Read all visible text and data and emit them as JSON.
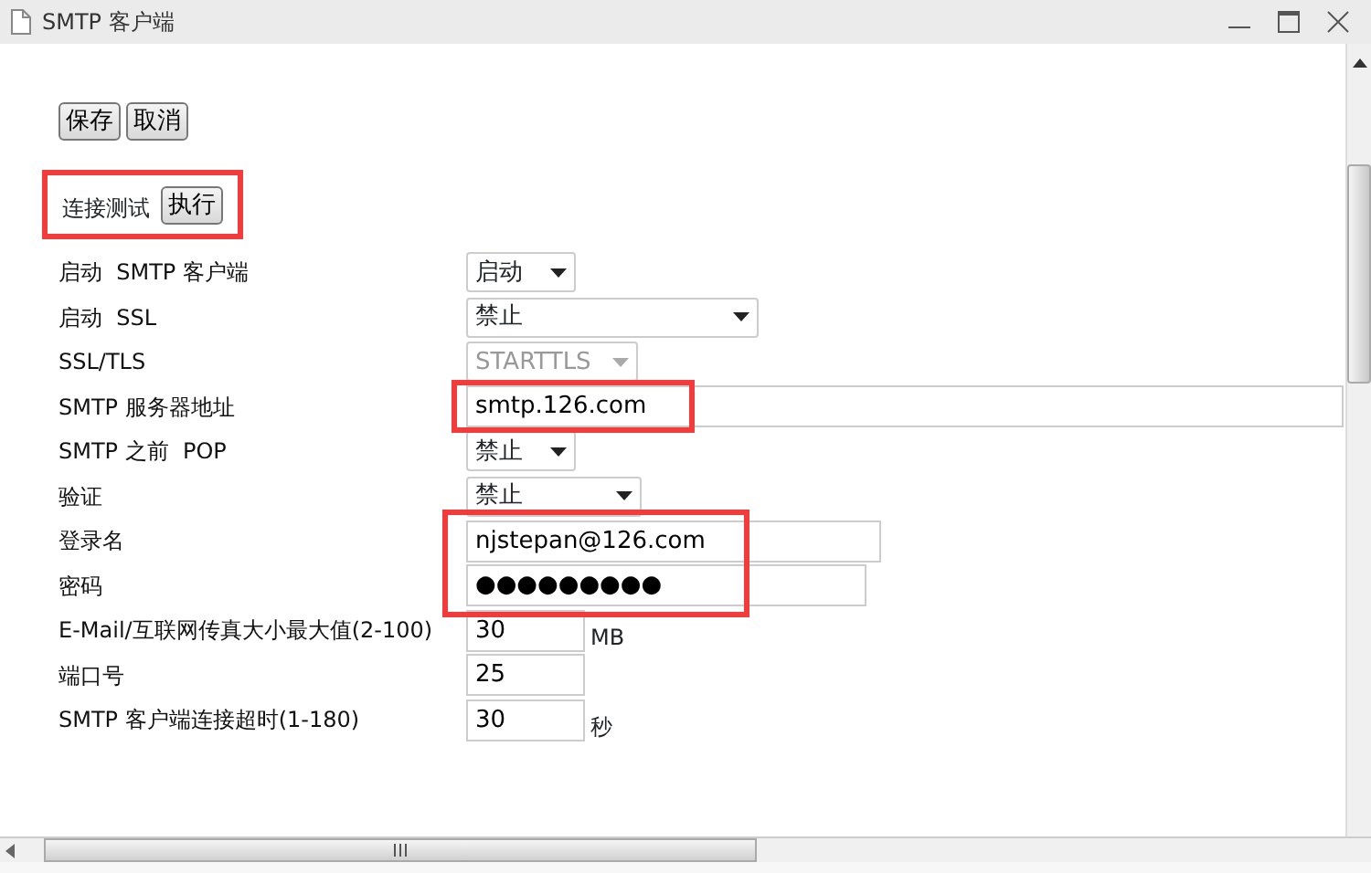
{
  "window": {
    "title": "SMTP 客户端"
  },
  "buttons": [
    {
      "label": "保存"
    },
    {
      "label": "取消"
    }
  ],
  "connection_test": {
    "label": "连接测试",
    "button": "执行",
    "highlighted": true
  },
  "settings": [
    {
      "label": "启动  SMTP 客户端",
      "kind": "select",
      "value": "启动",
      "disabled": false,
      "highlighted": false
    },
    {
      "label": "启动  SSL",
      "kind": "select",
      "value": "禁止",
      "disabled": false,
      "highlighted": false
    },
    {
      "label": "SSL/TLS",
      "kind": "select",
      "value": "STARTTLS",
      "disabled": true,
      "highlighted": false
    },
    {
      "label": "SMTP 服务器地址",
      "kind": "input",
      "value": "smtp.126.com",
      "highlighted": true
    },
    {
      "label": "SMTP 之前  POP",
      "kind": "select",
      "value": "禁止",
      "disabled": false,
      "highlighted": false
    },
    {
      "label": "验证",
      "kind": "select",
      "value": "禁止",
      "disabled": false,
      "highlighted": false
    },
    {
      "label": "登录名",
      "kind": "input",
      "value": "njstepan@126.com",
      "highlighted": true
    },
    {
      "label": "密码",
      "kind": "input",
      "value": "●●●●●●●●●",
      "highlighted": true
    },
    {
      "label": "E-Mail/互联网传真大小最大值(2-100)",
      "kind": "input",
      "value": "30",
      "unit": "MB",
      "highlighted": false
    },
    {
      "label": "端口号",
      "kind": "input",
      "value": "25",
      "highlighted": false
    },
    {
      "label": "SMTP 客户端连接超时(1-180)",
      "kind": "input",
      "value": "30",
      "unit": "秒",
      "highlighted": false
    }
  ]
}
